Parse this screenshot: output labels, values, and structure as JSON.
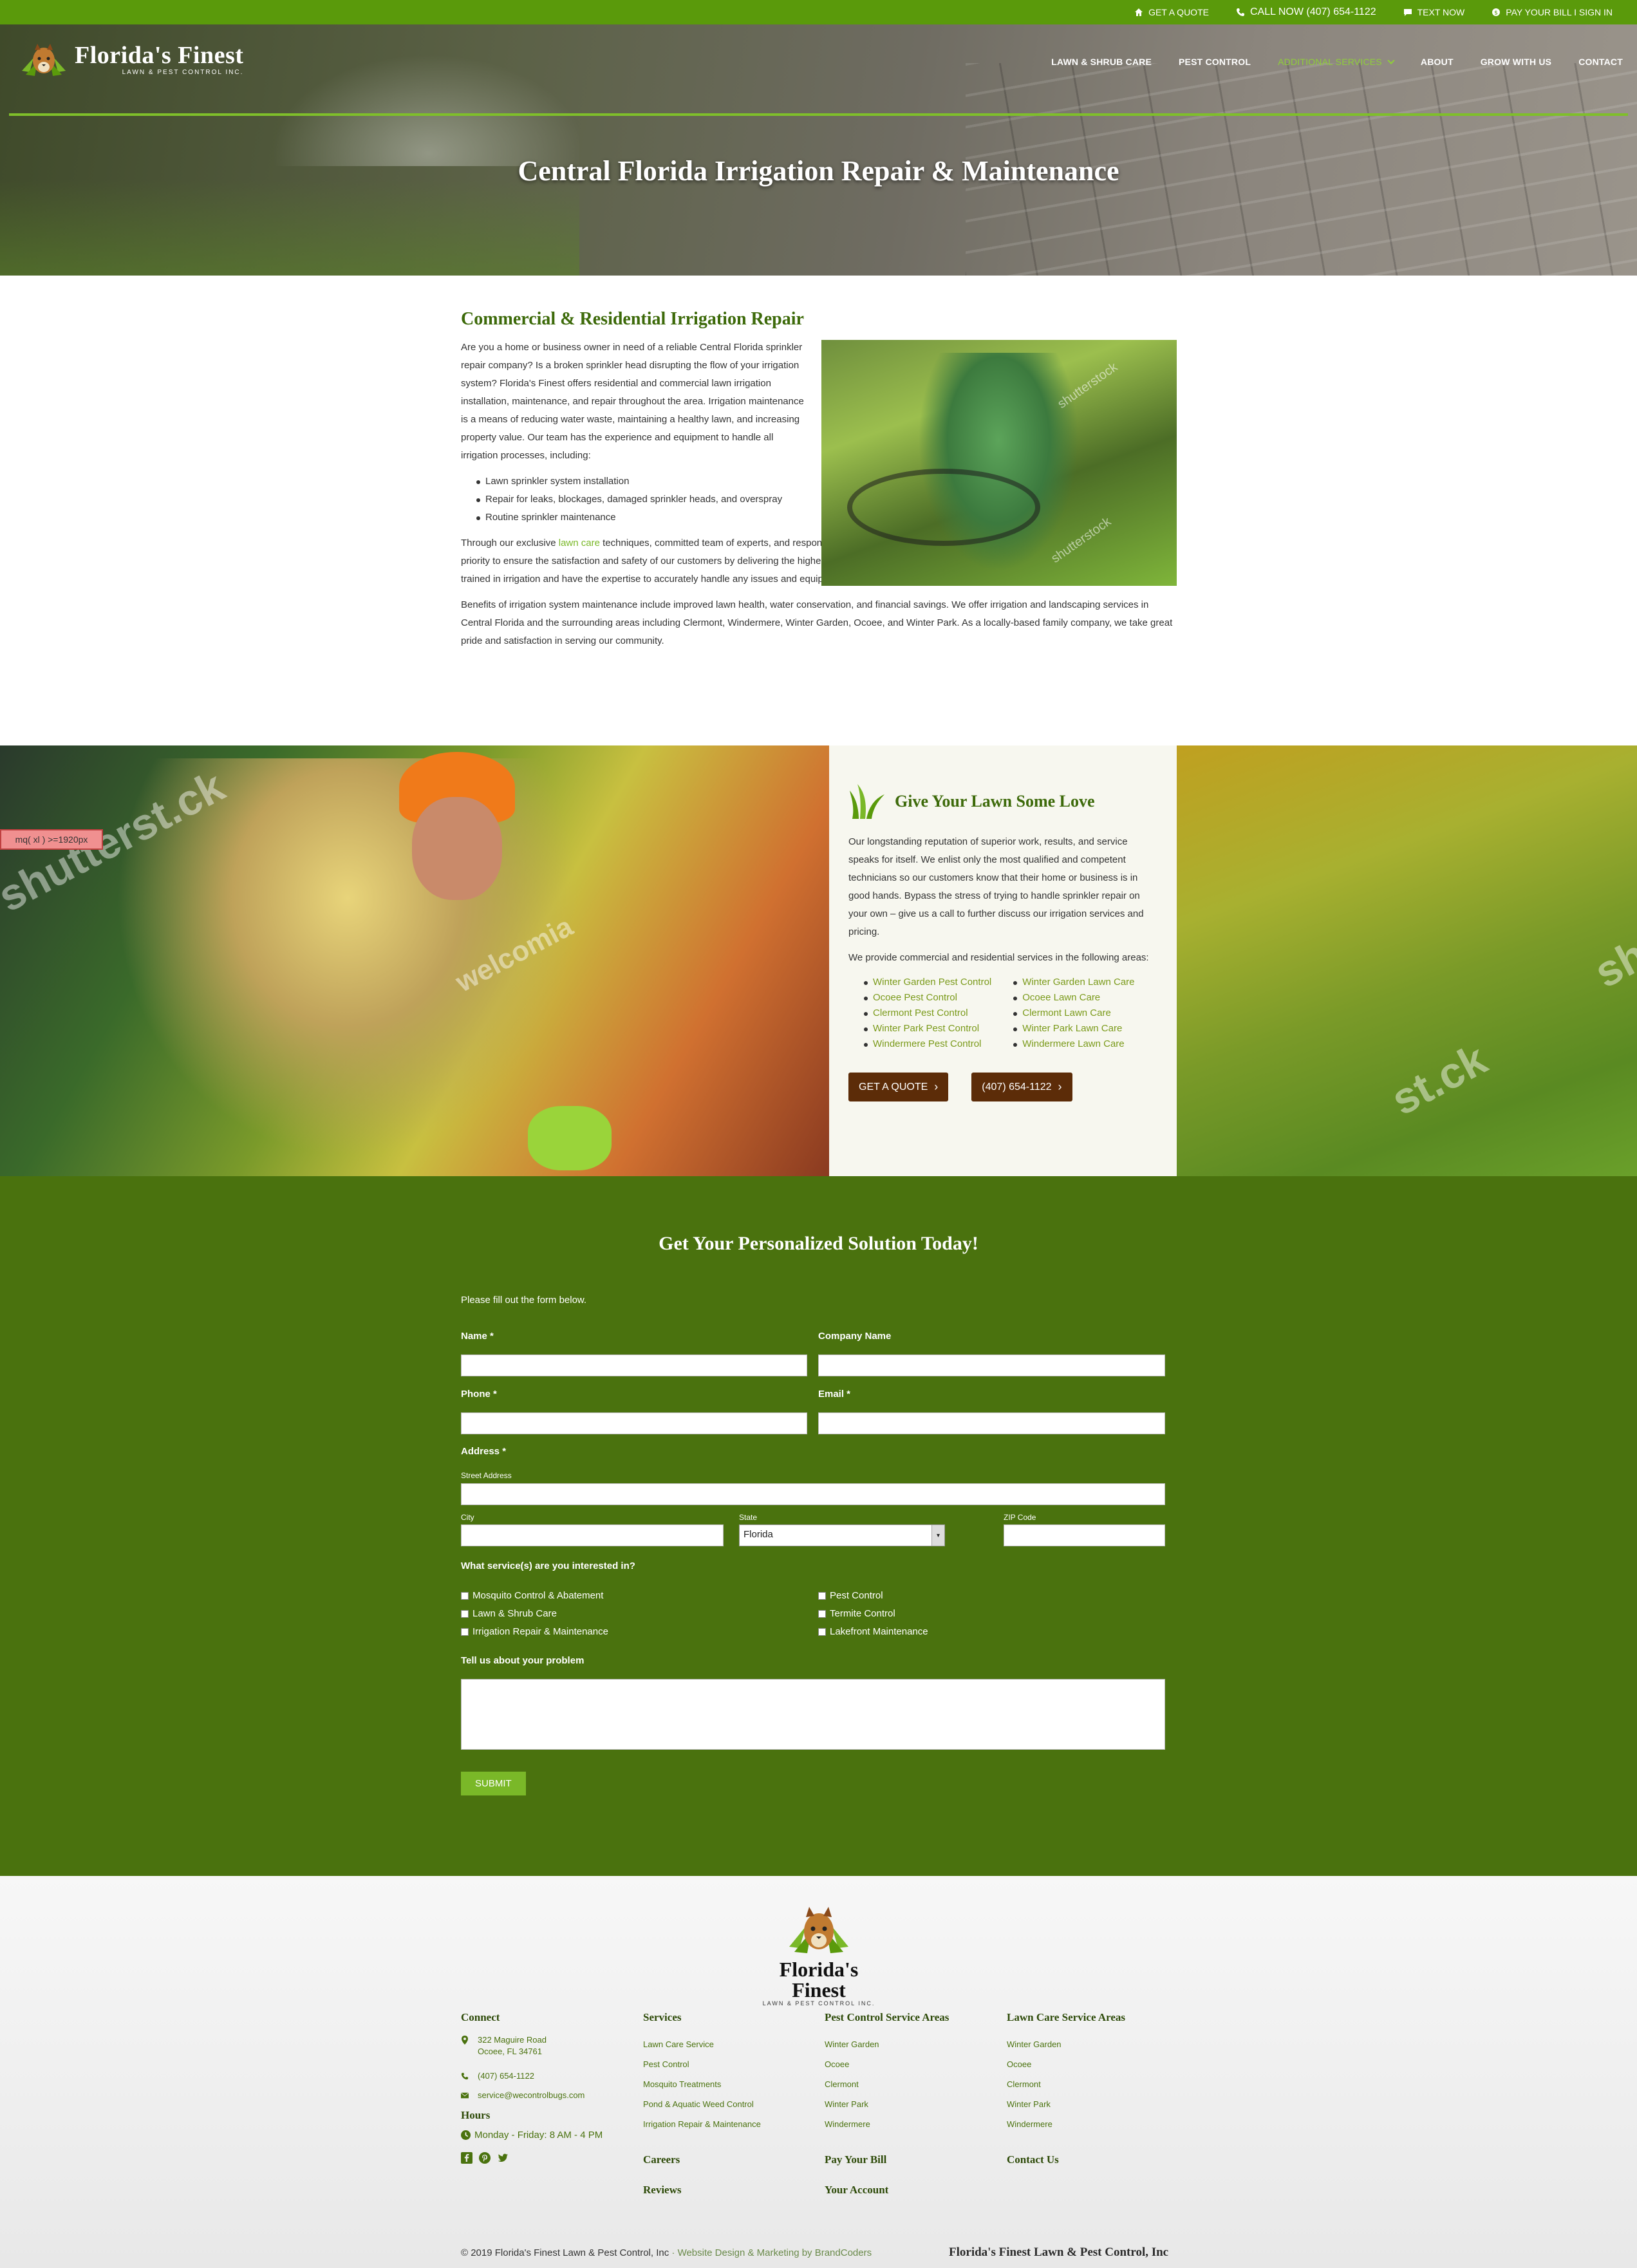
{
  "topbar": {
    "quote": "GET A QUOTE",
    "call": "CALL NOW (407) 654-1122",
    "text": "TEXT NOW",
    "pay": "PAY YOUR BILL I SIGN IN"
  },
  "brand": {
    "name": "Florida's Finest",
    "tagline": "LAWN & PEST CONTROL INC."
  },
  "nav": {
    "items": [
      "LAWN & SHRUB CARE",
      "PEST CONTROL",
      "ADDITIONAL SERVICES",
      "ABOUT",
      "GROW WITH US",
      "CONTACT"
    ],
    "active": "ADDITIONAL SERVICES"
  },
  "hero": {
    "title": "Central Florida Irrigation Repair & Maintenance"
  },
  "intro": {
    "heading": "Commercial & Residential Irrigation Repair",
    "p1": "Are you a home or business owner in need of a reliable Central Florida sprinkler repair company? Is a broken sprinkler head disrupting the flow of your irrigation system? Florida's Finest offers residential and commercial lawn irrigation installation, maintenance, and repair throughout the area. Irrigation maintenance is a means of reducing water waste, maintaining a healthy lawn, and increasing property value. Our team has the experience and equipment to handle all irrigation processes, including:",
    "bullets": [
      "Lawn sprinkler system installation",
      "Repair for leaks, blockages, damaged sprinkler heads, and overspray",
      "Routine sprinkler maintenance"
    ],
    "p2a": "Through our exclusive ",
    "p2link": "lawn care",
    "p2b": " techniques, committed team of experts, and responsive customer service, we have grown into a local powerhouse. We make it our top priority to ensure the satisfaction and safety of our customers by delivering the highest quality of service. Our sprinkler repair and maintenance technicians are well-trained in irrigation and have the expertise to accurately handle any issues and equipment.",
    "p3": "Benefits of irrigation system maintenance include improved lawn health, water conservation, and financial savings. We offer irrigation and landscaping services in Central Florida and the surrounding areas including Clermont, Windermere, Winter Garden, Ocoee, and Winter Park. As a locally-based family company, we take great pride and satisfaction in serving our community."
  },
  "love": {
    "heading": "Give Your Lawn Some Love",
    "p1": "Our longstanding reputation of superior work, results, and service speaks for itself. We enlist only the most qualified and competent technicians so our customers know that their home or business is in good hands. Bypass the stress of trying to handle sprinkler repair on your own – give us a call to further discuss our irrigation services and pricing.",
    "p2": "We provide commercial and residential services in the following areas:",
    "pest": [
      "Winter Garden Pest Control",
      "Ocoee Pest Control",
      "Clermont Pest Control",
      "Winter Park Pest Control",
      "Windermere Pest Control"
    ],
    "lawn": [
      "Winter Garden Lawn Care",
      "Ocoee Lawn Care",
      "Clermont Lawn Care",
      "Winter Park Lawn Care",
      "Windermere Lawn Care"
    ],
    "btn1": "GET A QUOTE",
    "btn2": "(407) 654-1122"
  },
  "mq": "mq( xl ) >=1920px",
  "form": {
    "heading": "Get Your Personalized Solution Today!",
    "intro": "Please fill out the form below.",
    "name": "Name *",
    "company": "Company Name",
    "phone": "Phone *",
    "email": "Email *",
    "address": "Address *",
    "street": "Street Address",
    "city": "City",
    "state": "State",
    "state_value": "Florida",
    "zip": "ZIP Code",
    "services_q": "What service(s) are you interested in?",
    "services": [
      "Mosquito Control & Abatement",
      "Lawn & Shrub Care",
      "Irrigation Repair & Maintenance",
      "Pest Control",
      "Termite Control",
      "Lakefront Maintenance"
    ],
    "problem": "Tell us about your problem",
    "submit": "SUBMIT"
  },
  "footer": {
    "connect_h": "Connect",
    "addr1": "322 Maguire Road",
    "addr2": "Ocoee, FL 34761",
    "phone": "(407) 654-1122",
    "email": "service@wecontrolbugs.com",
    "hours_h": "Hours",
    "hours": "Monday - Friday: 8 AM - 4 PM",
    "services_h": "Services",
    "services": [
      "Lawn Care Service",
      "Pest Control",
      "Mosquito Treatments",
      "Pond & Aquatic Weed Control",
      "Irrigation Repair & Maintenance"
    ],
    "careers": "Careers",
    "reviews": "Reviews",
    "pest_h": "Pest Control Service Areas",
    "pest": [
      "Winter Garden",
      "Ocoee",
      "Clermont",
      "Winter Park",
      "Windermere"
    ],
    "pay": "Pay Your Bill",
    "account": "Your Account",
    "lawn_h": "Lawn Care Service Areas",
    "lawn": [
      "Winter Garden",
      "Ocoee",
      "Clermont",
      "Winter Park",
      "Windermere"
    ],
    "contact": "Contact Us",
    "copyright": "© 2019 Florida's Finest Lawn & Pest Control, Inc",
    "credit": " · Website Design & Marketing by BrandCoders",
    "company": "Florida's Finest Lawn & Pest Control, Inc"
  },
  "colors": {
    "brand_green": "#5a9a0b",
    "form_green": "#4a720e",
    "accent_green": "#7ab828",
    "button_brown": "#5c2c08"
  }
}
